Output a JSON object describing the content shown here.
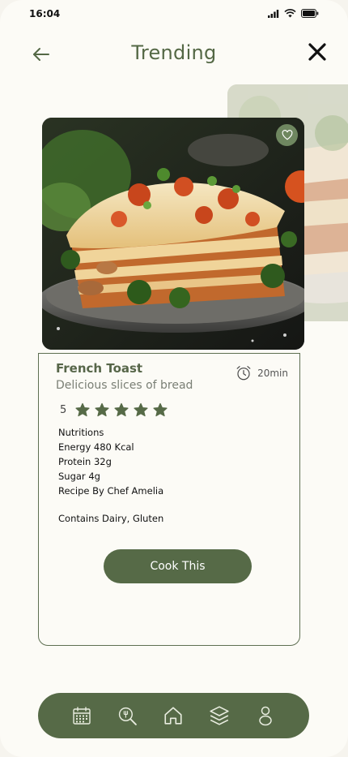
{
  "status_bar": {
    "time": "16:04"
  },
  "header": {
    "title": "Trending"
  },
  "recipe": {
    "name": "French Toast",
    "description": "Delicious slices of bread",
    "time": "20min",
    "rating": "5",
    "rating_stars_filled": 5,
    "nutrition": {
      "heading": "Nutritions",
      "energy": "Energy 480 Kcal",
      "protein": "Protein 32g",
      "sugar": "Sugar 4g",
      "chef": "Recipe By Chef Amelia"
    },
    "allergens": "Contains Dairy, Gluten",
    "cook_label": "Cook This"
  },
  "nav": {
    "items": [
      {
        "icon": "calendar-icon"
      },
      {
        "icon": "search-icon"
      },
      {
        "icon": "home-icon"
      },
      {
        "icon": "layers-icon"
      },
      {
        "icon": "profile-icon"
      }
    ]
  },
  "colors": {
    "accent": "#566a47",
    "title": "#546845",
    "background": "#fcfbf6"
  }
}
